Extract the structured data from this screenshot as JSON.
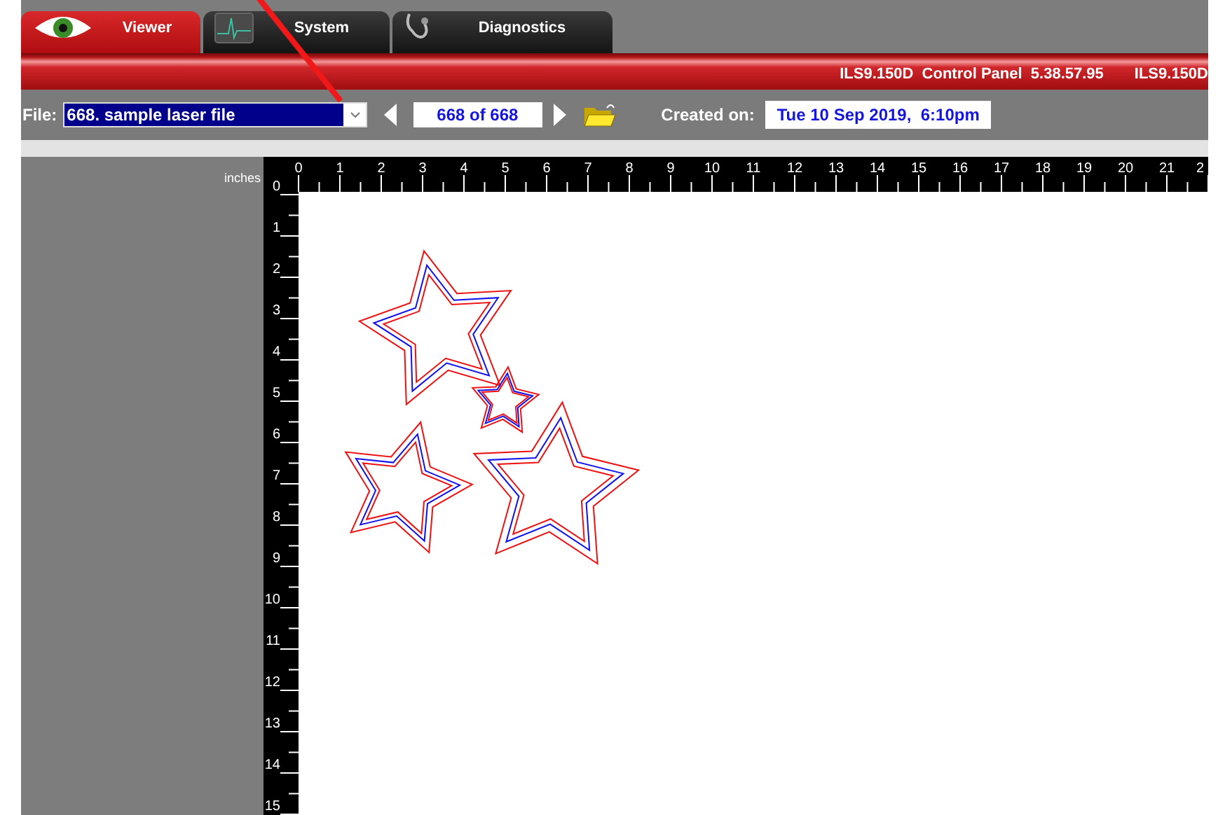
{
  "tabs": [
    {
      "label": "Viewer",
      "kind": "eye",
      "selected": true
    },
    {
      "label": "System",
      "kind": "waveform",
      "selected": false
    },
    {
      "label": "Diagnostics",
      "kind": "stethoscope",
      "selected": false
    }
  ],
  "title_bar": {
    "texts": [
      "ILS9.150D  Control Panel  5.38.57.95",
      "ILS9.150D"
    ]
  },
  "toolbar": {
    "file_label": "File:",
    "file": {
      "value": "668. sample laser file"
    },
    "counter": "668 of 668",
    "created_label": "Created on:",
    "created": "Tue 10 Sep 2019,  6:10pm"
  },
  "ruler": {
    "unit": "inches",
    "x_labels": [
      "0",
      "1",
      "2",
      "3",
      "4",
      "5",
      "6",
      "7",
      "8",
      "9",
      "10",
      "11",
      "12",
      "13",
      "14",
      "15",
      "16",
      "17",
      "18",
      "19",
      "20",
      "21",
      "2"
    ],
    "y_labels": [
      "0",
      "1",
      "2",
      "3",
      "4",
      "5",
      "6",
      "7",
      "8",
      "9",
      "10",
      "11",
      "12",
      "13",
      "14",
      "15"
    ]
  }
}
